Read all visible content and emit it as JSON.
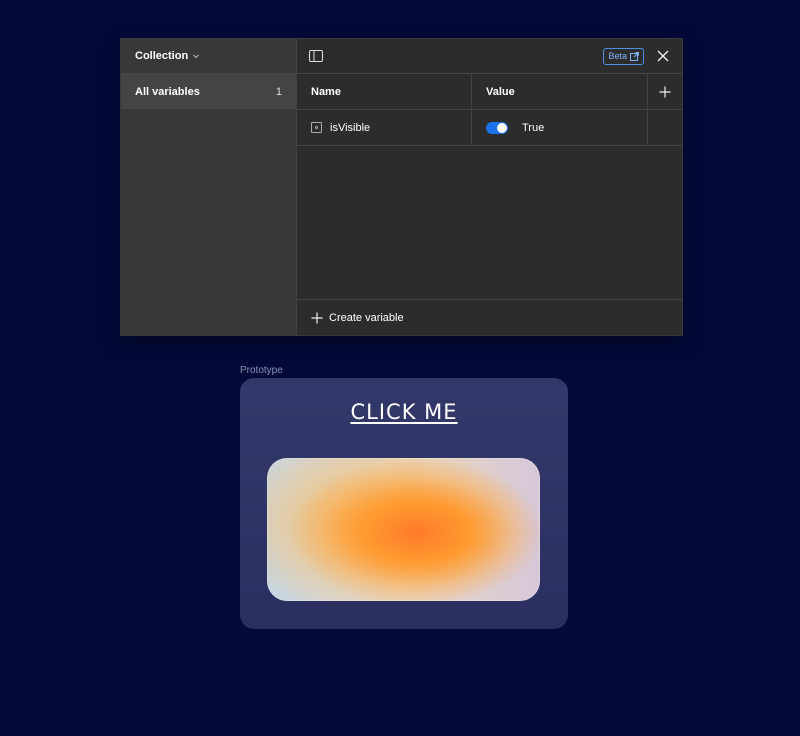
{
  "variables_panel": {
    "collection_label": "Collection",
    "collections": [
      {
        "label": "All variables",
        "count": "1"
      }
    ],
    "beta_badge": "Beta",
    "columns": {
      "name": "Name",
      "value": "Value"
    },
    "variables": [
      {
        "name": "isVisible",
        "type": "boolean",
        "value": "True"
      }
    ],
    "create_label": "Create variable"
  },
  "prototype": {
    "label": "Prototype",
    "cta_text": "CLICK ME"
  },
  "colors": {
    "background": "#030a3a",
    "panel": "#2c2c2c",
    "accent": "#1a73e8"
  }
}
